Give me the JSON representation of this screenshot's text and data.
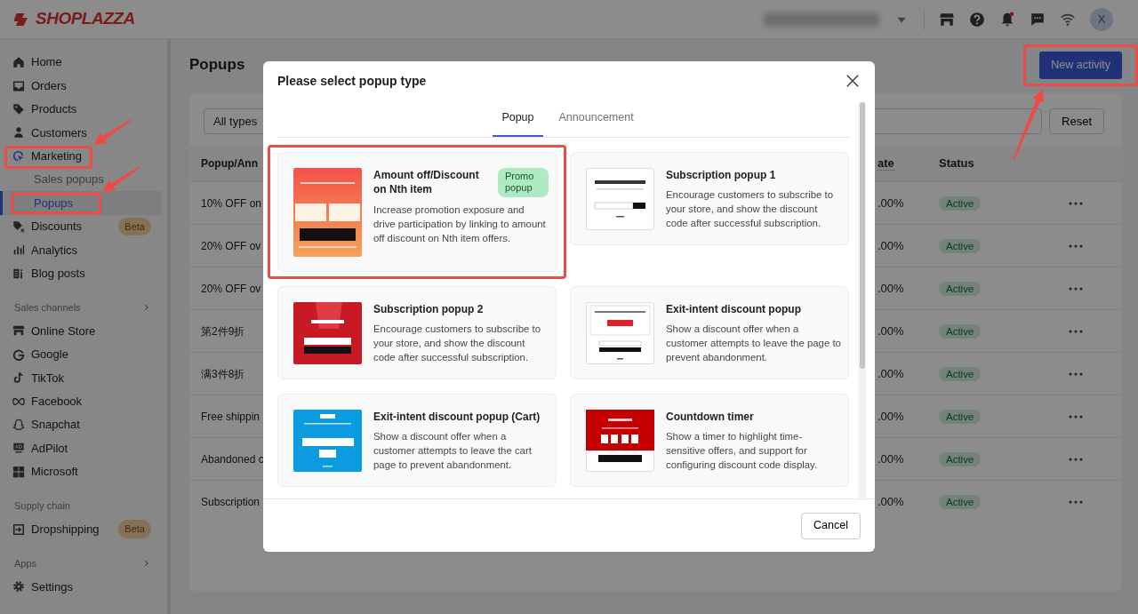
{
  "topbar": {
    "logo": "SHOPLAZZA",
    "has_unread": true,
    "avatar": "X"
  },
  "sidebar": {
    "items": [
      {
        "kind": "item",
        "label": "Home",
        "selected": false,
        "highlighted": false
      },
      {
        "kind": "item",
        "label": "Orders",
        "selected": false,
        "highlighted": false
      },
      {
        "kind": "item",
        "label": "Products",
        "selected": false,
        "highlighted": false
      },
      {
        "kind": "item",
        "label": "Customers",
        "selected": false,
        "highlighted": false
      },
      {
        "kind": "item",
        "label": "Marketing",
        "selected": false,
        "highlighted": true,
        "arrow": true
      },
      {
        "kind": "subitem",
        "label": "Sales popups",
        "selected": false,
        "highlighted": false
      },
      {
        "kind": "subitem",
        "label": "Popups",
        "selected": true,
        "highlighted": true,
        "arrow": true
      },
      {
        "kind": "item",
        "label": "Discounts",
        "badge": "Beta",
        "selected": false,
        "highlighted": false
      },
      {
        "kind": "item",
        "label": "Analytics",
        "selected": false,
        "highlighted": false
      },
      {
        "kind": "item",
        "label": "Blog posts",
        "selected": false,
        "highlighted": false
      },
      {
        "kind": "section",
        "label": "Sales channels",
        "expandable": true
      },
      {
        "kind": "item",
        "label": "Online Store",
        "selected": false,
        "highlighted": false
      },
      {
        "kind": "item",
        "label": "Google",
        "selected": false,
        "highlighted": false
      },
      {
        "kind": "item",
        "label": "TikTok",
        "selected": false,
        "highlighted": false
      },
      {
        "kind": "item",
        "label": "Facebook",
        "selected": false,
        "highlighted": false
      },
      {
        "kind": "item",
        "label": "Snapchat",
        "selected": false,
        "highlighted": false
      },
      {
        "kind": "item",
        "label": "AdPilot",
        "selected": false,
        "highlighted": false
      },
      {
        "kind": "item",
        "label": "Microsoft",
        "selected": false,
        "highlighted": false
      },
      {
        "kind": "section",
        "label": "Supply chain",
        "expandable": false
      },
      {
        "kind": "item",
        "label": "Dropshipping",
        "badge": "Beta",
        "selected": false,
        "highlighted": false
      },
      {
        "kind": "section",
        "label": "Apps",
        "expandable": true
      },
      {
        "kind": "item",
        "label": "Settings",
        "selected": false,
        "highlighted": false
      }
    ]
  },
  "page": {
    "title": "Popups",
    "new_button": {
      "label": "New activity",
      "highlighted": true,
      "arrow": true
    },
    "filter": {
      "type_select": "All types",
      "reset": "Reset"
    },
    "table": {
      "columns": [
        "Popup/Ann",
        "ate",
        "Status"
      ],
      "rows": [
        {
          "name": "10% OFF on",
          "rate": ".00%",
          "status": "Active"
        },
        {
          "name": "20% OFF ov",
          "rate": ".00%",
          "status": "Active"
        },
        {
          "name": "20% OFF ov",
          "rate": ".00%",
          "status": "Active"
        },
        {
          "name": "第2件9折",
          "rate": ".00%",
          "status": "Active"
        },
        {
          "name": "满3件8折",
          "rate": ".00%",
          "status": "Active"
        },
        {
          "name": "Free shippin",
          "rate": ".00%",
          "status": "Active"
        },
        {
          "name": "Abandoned c",
          "rate": ".00%",
          "status": "Active"
        },
        {
          "name": "Subscription",
          "rate": ".00%",
          "status": "Active"
        }
      ]
    }
  },
  "modal": {
    "title": "Please select popup type",
    "tabs": [
      {
        "label": "Popup",
        "selected": true
      },
      {
        "label": "Announcement",
        "selected": false
      }
    ],
    "cards": [
      {
        "kind": "coupon",
        "title": "Amount off/Discount on Nth item",
        "badge": "Promo popup",
        "description": "Increase promotion exposure and drive participation by linking to amount off discount on Nth item offers.",
        "highlighted": true,
        "arrow": false
      },
      {
        "kind": "newsletter",
        "title": "Subscription popup 1",
        "description": "Encourage customers to subscribe to your store, and show the discount code after successful subscription.",
        "highlighted": false
      },
      {
        "kind": "festive",
        "title": "Subscription popup 2",
        "description": "Encourage customers to subscribe to your store, and show the discount code after successful subscription.",
        "highlighted": false
      },
      {
        "kind": "exit",
        "title": "Exit-intent discount popup",
        "description": "Show a discount offer when a customer attempts to leave the page to prevent abandonment.",
        "highlighted": false
      },
      {
        "kind": "wait",
        "title": "Exit-intent discount popup (Cart)",
        "description": "Show a discount offer when a customer attempts to leave the cart page to prevent abandonment.",
        "highlighted": false
      },
      {
        "kind": "countdown",
        "title": "Countdown timer",
        "description": "Show a timer to highlight time-sensitive offers, and support for configuring discount code display.",
        "highlighted": false
      }
    ],
    "cancel": "Cancel"
  }
}
